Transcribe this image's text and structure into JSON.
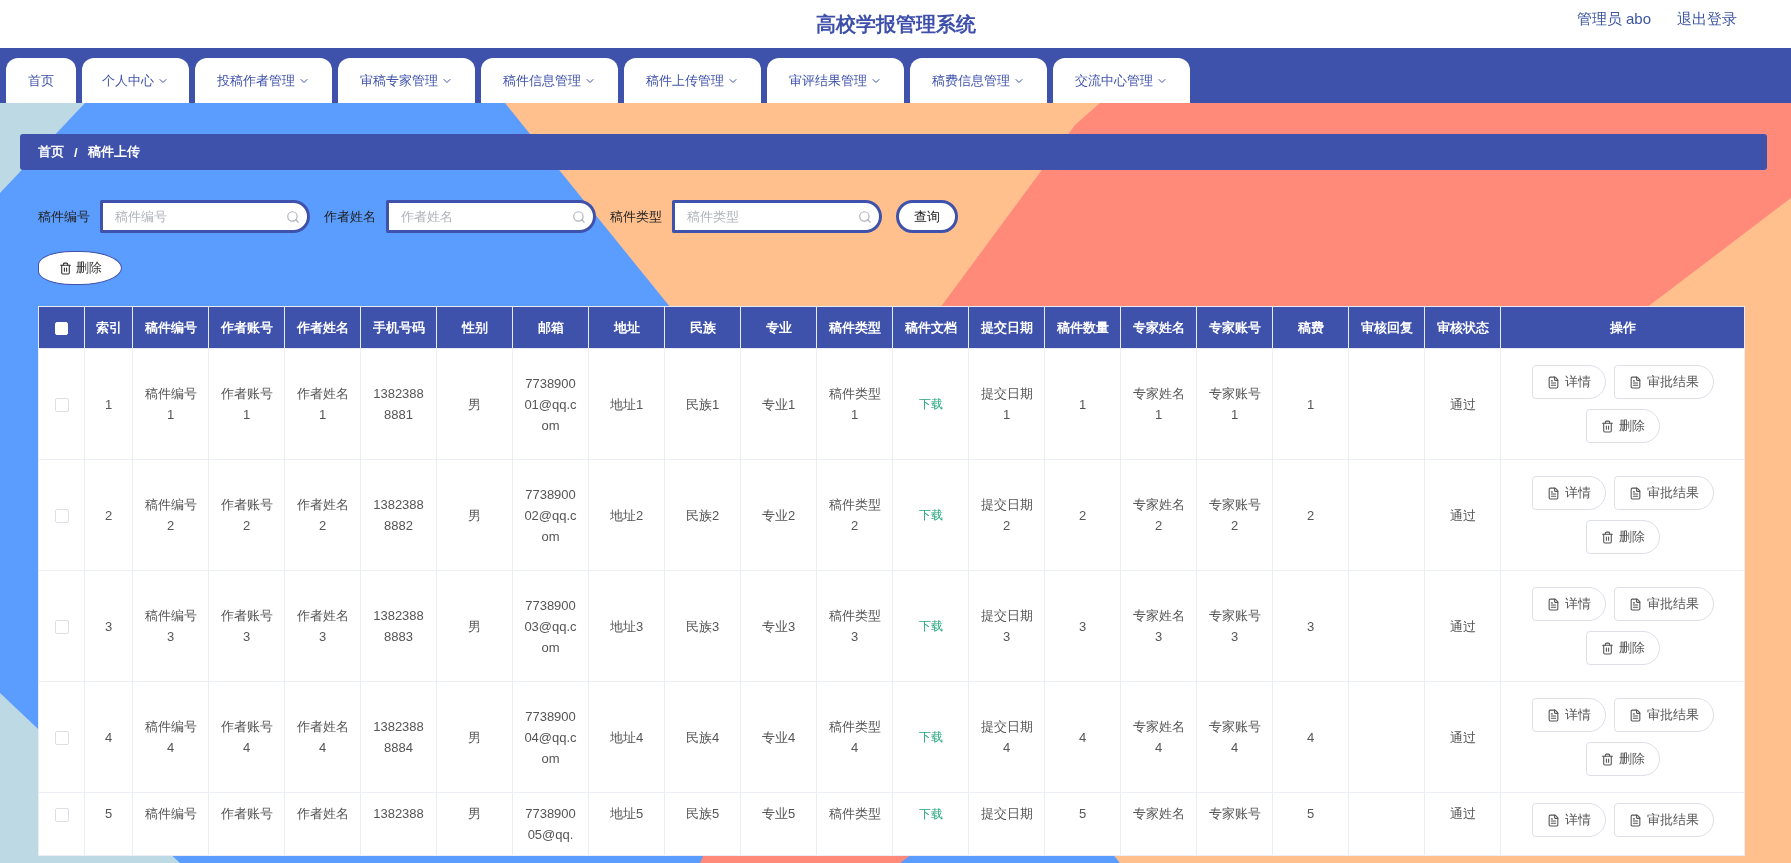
{
  "header": {
    "title": "高校学报管理系统",
    "user": "管理员 abo",
    "logout": "退出登录"
  },
  "nav": [
    {
      "label": "首页",
      "dropdown": false
    },
    {
      "label": "个人中心",
      "dropdown": true
    },
    {
      "label": "投稿作者管理",
      "dropdown": true
    },
    {
      "label": "审稿专家管理",
      "dropdown": true
    },
    {
      "label": "稿件信息管理",
      "dropdown": true
    },
    {
      "label": "稿件上传管理",
      "dropdown": true
    },
    {
      "label": "审评结果管理",
      "dropdown": true
    },
    {
      "label": "稿费信息管理",
      "dropdown": true
    },
    {
      "label": "交流中心管理",
      "dropdown": true
    }
  ],
  "breadcrumb": {
    "home": "首页",
    "separator": "/",
    "current": "稿件上传"
  },
  "search": {
    "fields": [
      {
        "label": "稿件编号",
        "placeholder": "稿件编号"
      },
      {
        "label": "作者姓名",
        "placeholder": "作者姓名"
      },
      {
        "label": "稿件类型",
        "placeholder": "稿件类型"
      }
    ],
    "button": "查询"
  },
  "delete_button": "删除",
  "table": {
    "select_all": {
      "checked": false
    },
    "columns": [
      {
        "label": "索引",
        "kind": "text"
      },
      {
        "label": "稿件编号",
        "kind": "text"
      },
      {
        "label": "作者账号",
        "kind": "text"
      },
      {
        "label": "作者姓名",
        "kind": "text"
      },
      {
        "label": "手机号码",
        "kind": "text"
      },
      {
        "label": "性别",
        "kind": "text"
      },
      {
        "label": "邮箱",
        "kind": "text"
      },
      {
        "label": "地址",
        "kind": "text"
      },
      {
        "label": "民族",
        "kind": "text"
      },
      {
        "label": "专业",
        "kind": "text"
      },
      {
        "label": "稿件类型",
        "kind": "text"
      },
      {
        "label": "稿件文档",
        "kind": "link"
      },
      {
        "label": "提交日期",
        "kind": "text"
      },
      {
        "label": "稿件数量",
        "kind": "text"
      },
      {
        "label": "专家姓名",
        "kind": "text"
      },
      {
        "label": "专家账号",
        "kind": "text"
      },
      {
        "label": "稿费",
        "kind": "text"
      },
      {
        "label": "审核回复",
        "kind": "text"
      },
      {
        "label": "审核状态",
        "kind": "text"
      }
    ],
    "actions_header": "操作",
    "rows": [
      {
        "checked": false,
        "cells": [
          "1",
          "稿件编号1",
          "作者账号1",
          "作者姓名1",
          "13823888881",
          "男",
          "773890001@qq.com",
          "地址1",
          "民族1",
          "专业1",
          "稿件类型1",
          "下载",
          "提交日期1",
          "1",
          "专家姓名1",
          "专家账号1",
          "1",
          null,
          "通过"
        ],
        "actions": [
          {
            "kind": "detail",
            "label": "详情"
          },
          {
            "kind": "result",
            "label": "审批结果"
          },
          {
            "kind": "delete",
            "label": "删除"
          }
        ]
      },
      {
        "checked": false,
        "cells": [
          "2",
          "稿件编号2",
          "作者账号2",
          "作者姓名2",
          "13823888882",
          "男",
          "773890002@qq.com",
          "地址2",
          "民族2",
          "专业2",
          "稿件类型2",
          "下载",
          "提交日期2",
          "2",
          "专家姓名2",
          "专家账号2",
          "2",
          null,
          "通过"
        ],
        "actions": [
          {
            "kind": "detail",
            "label": "详情"
          },
          {
            "kind": "result",
            "label": "审批结果"
          },
          {
            "kind": "delete",
            "label": "删除"
          }
        ]
      },
      {
        "checked": false,
        "cells": [
          "3",
          "稿件编号3",
          "作者账号3",
          "作者姓名3",
          "13823888883",
          "男",
          "773890003@qq.com",
          "地址3",
          "民族3",
          "专业3",
          "稿件类型3",
          "下载",
          "提交日期3",
          "3",
          "专家姓名3",
          "专家账号3",
          "3",
          null,
          "通过"
        ],
        "actions": [
          {
            "kind": "detail",
            "label": "详情"
          },
          {
            "kind": "result",
            "label": "审批结果"
          },
          {
            "kind": "delete",
            "label": "删除"
          }
        ]
      },
      {
        "checked": false,
        "cells": [
          "4",
          "稿件编号4",
          "作者账号4",
          "作者姓名4",
          "13823888884",
          "男",
          "773890004@qq.com",
          "地址4",
          "民族4",
          "专业4",
          "稿件类型4",
          "下载",
          "提交日期4",
          "4",
          "专家姓名4",
          "专家账号4",
          "4",
          null,
          "通过"
        ],
        "actions": [
          {
            "kind": "detail",
            "label": "详情"
          },
          {
            "kind": "result",
            "label": "审批结果"
          },
          {
            "kind": "delete",
            "label": "删除"
          }
        ]
      },
      {
        "checked": false,
        "cells": [
          "5",
          "稿件编号",
          "作者账号",
          "作者姓名",
          "1382388",
          "男",
          "773890005@qq.",
          "地址5",
          "民族5",
          "专业5",
          "稿件类型",
          "下载",
          "提交日期",
          "5",
          "专家姓名",
          "专家账号",
          "5",
          null,
          "通过"
        ],
        "actions": [
          {
            "kind": "detail",
            "label": "详情"
          },
          {
            "kind": "result",
            "label": "审批结果"
          }
        ]
      }
    ]
  }
}
